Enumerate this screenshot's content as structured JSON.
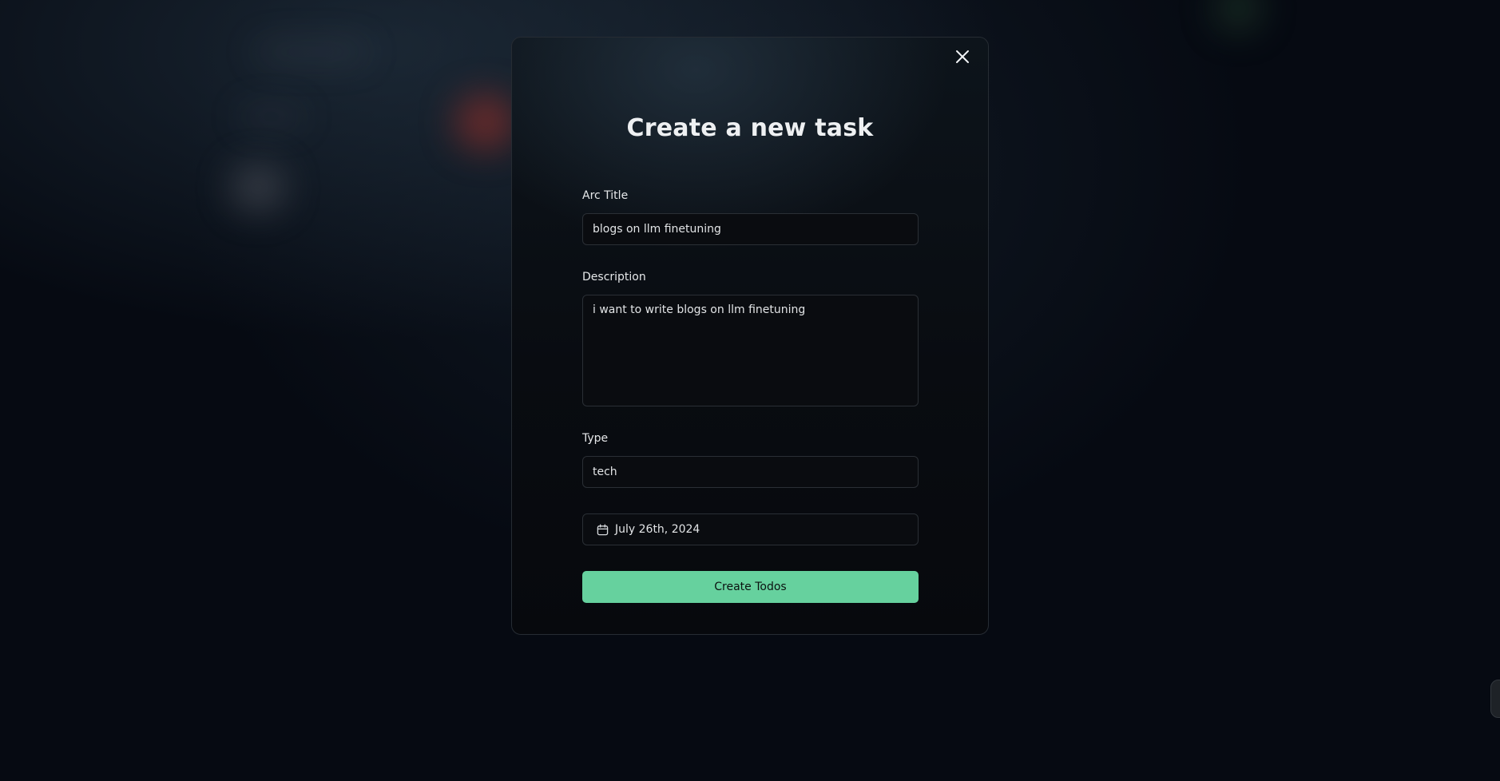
{
  "modal": {
    "title": "Create a new task",
    "close_icon": "close-icon",
    "fields": {
      "title": {
        "label": "Arc Title",
        "value": "blogs on llm finetuning"
      },
      "description": {
        "label": "Description",
        "value": "i want to write blogs on llm finetuning"
      },
      "type": {
        "label": "Type",
        "value": "tech"
      },
      "date": {
        "icon": "calendar-icon",
        "value": "July 26th, 2024"
      }
    },
    "submit_label": "Create Todos"
  },
  "colors": {
    "accent": "#66d19e",
    "background": "#060a12",
    "border": "#2a2f35"
  }
}
